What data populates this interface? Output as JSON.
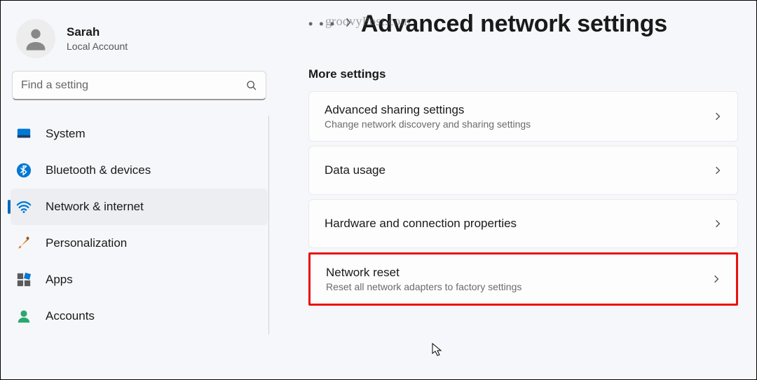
{
  "profile": {
    "name": "Sarah",
    "account_type": "Local Account"
  },
  "search": {
    "placeholder": "Find a setting"
  },
  "sidebar": {
    "items": [
      {
        "label": "System",
        "icon": "system-icon",
        "active": false
      },
      {
        "label": "Bluetooth & devices",
        "icon": "bluetooth-icon",
        "active": false
      },
      {
        "label": "Network & internet",
        "icon": "wifi-icon",
        "active": true
      },
      {
        "label": "Personalization",
        "icon": "brush-icon",
        "active": false
      },
      {
        "label": "Apps",
        "icon": "apps-icon",
        "active": false
      },
      {
        "label": "Accounts",
        "icon": "person-icon",
        "active": false
      }
    ]
  },
  "breadcrumb": {
    "dots": "• • •",
    "chevron": "›"
  },
  "page_title": "Advanced network settings",
  "section_label": "More settings",
  "cards": [
    {
      "title": "Advanced sharing settings",
      "subtitle": "Change network discovery and sharing settings",
      "highlight": false
    },
    {
      "title": "Data usage",
      "subtitle": "",
      "highlight": false
    },
    {
      "title": "Hardware and connection properties",
      "subtitle": "",
      "highlight": false
    },
    {
      "title": "Network reset",
      "subtitle": "Reset all network adapters to factory settings",
      "highlight": true
    }
  ],
  "watermark": "groovyPost.com"
}
